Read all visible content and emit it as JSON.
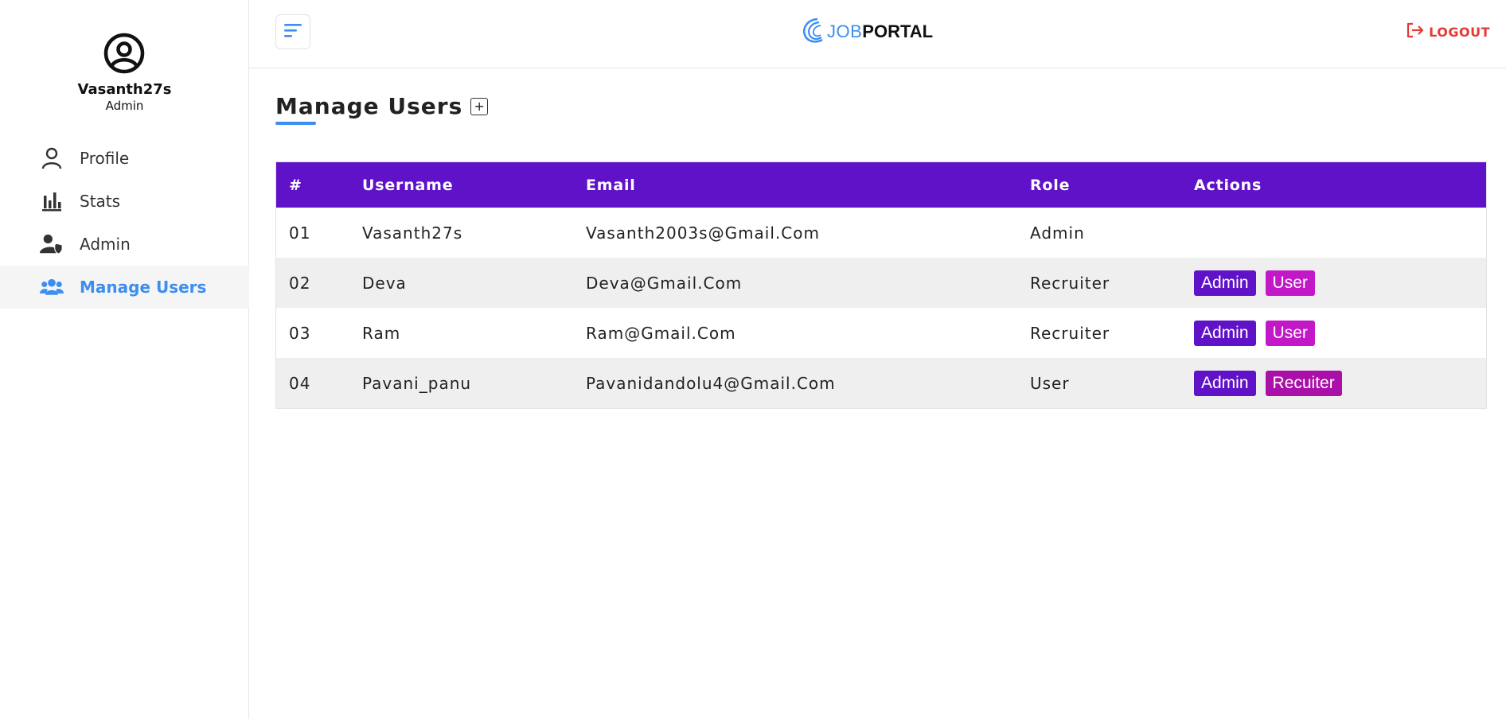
{
  "sidebar": {
    "user": {
      "name": "Vasanth27s",
      "role": "Admin"
    },
    "items": [
      {
        "label": "Profile",
        "icon": "user-icon",
        "active": false
      },
      {
        "label": "Stats",
        "icon": "bar-chart-icon",
        "active": false
      },
      {
        "label": "Admin",
        "icon": "user-shield-icon",
        "active": false
      },
      {
        "label": "Manage Users",
        "icon": "users-icon",
        "active": true
      }
    ]
  },
  "header": {
    "logo_job": "JOB",
    "logo_portal": "PORTAL",
    "logout_label": "LOGOUT"
  },
  "main": {
    "title": "Manage Users",
    "table": {
      "columns": [
        "#",
        "Username",
        "Email",
        "Role",
        "Actions"
      ],
      "rows": [
        {
          "num": "01",
          "username": "Vasanth27s",
          "email": "Vasanth2003s@Gmail.Com",
          "role": "Admin",
          "actions": []
        },
        {
          "num": "02",
          "username": "Deva",
          "email": "Deva@Gmail.Com",
          "role": "Recruiter",
          "actions": [
            "Admin",
            "User"
          ]
        },
        {
          "num": "03",
          "username": "Ram",
          "email": "Ram@Gmail.Com",
          "role": "Recruiter",
          "actions": [
            "Admin",
            "User"
          ]
        },
        {
          "num": "04",
          "username": "Pavani_panu",
          "email": "Pavanidandolu4@Gmail.Com",
          "role": "User",
          "actions": [
            "Admin",
            "Recuiter"
          ]
        }
      ]
    }
  },
  "colors": {
    "accent": "#3d8ef0",
    "table_header": "#6012c8",
    "btn_admin": "#6012c8",
    "btn_user": "#c218c8",
    "btn_recruiter": "#aa10a8",
    "logout": "#e53935"
  }
}
